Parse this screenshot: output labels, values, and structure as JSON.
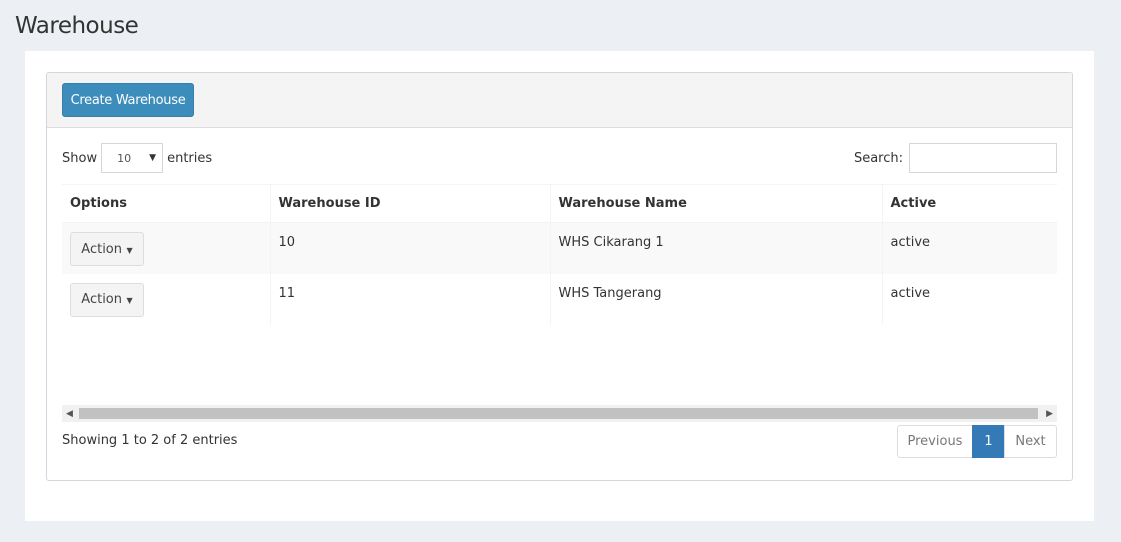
{
  "page": {
    "title": "Warehouse"
  },
  "toolbar": {
    "create_label": "Create Warehouse"
  },
  "length": {
    "show_label": "Show",
    "selected": "10",
    "entries_label": "entries"
  },
  "search": {
    "label": "Search:",
    "value": ""
  },
  "table": {
    "headers": [
      "Options",
      "Warehouse ID",
      "Warehouse Name",
      "Active"
    ],
    "rows": [
      {
        "action": "Action",
        "id": "10",
        "name": "WHS Cikarang 1",
        "active": "active"
      },
      {
        "action": "Action",
        "id": "11",
        "name": "WHS Tangerang",
        "active": "active"
      }
    ]
  },
  "footer": {
    "info": "Showing 1 to 2 of 2 entries",
    "prev": "Previous",
    "current_page": "1",
    "next": "Next"
  },
  "colors": {
    "primary": "#3c8dbc",
    "page_active": "#337ab7",
    "background": "#ecf0f5"
  }
}
